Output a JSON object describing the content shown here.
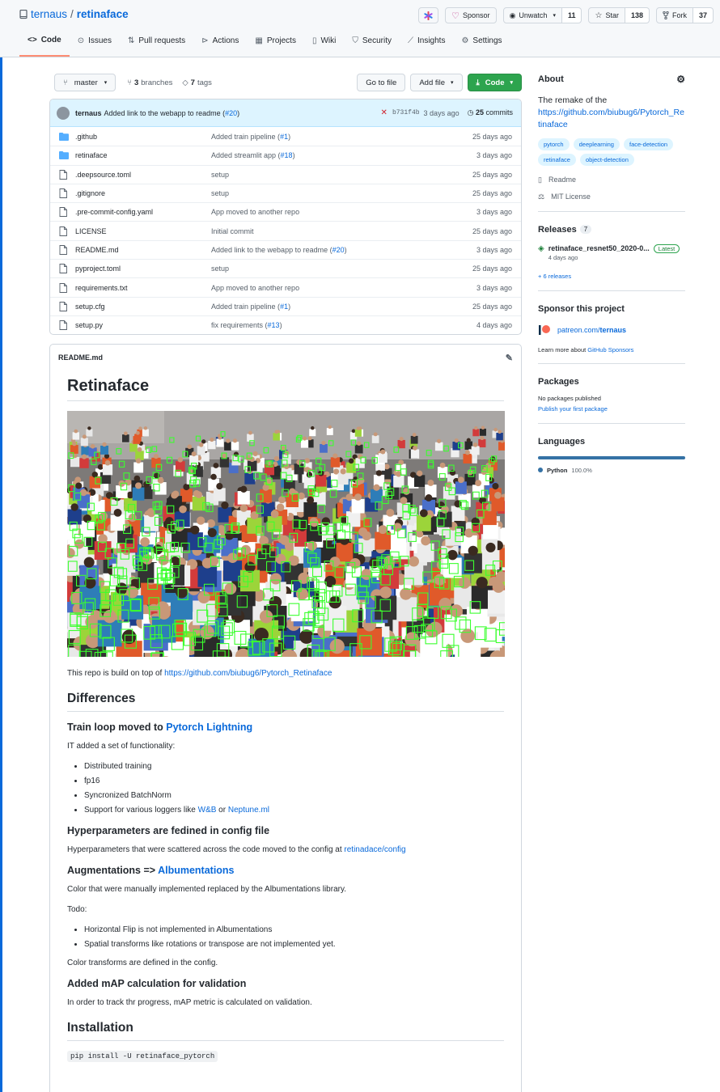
{
  "repo": {
    "owner": "ternaus",
    "separator": "/",
    "name": "retinaface",
    "sponsor_label": "Sponsor",
    "unwatch_label": "Unwatch",
    "watch_count": "11",
    "star_label": "Star",
    "star_count": "138",
    "fork_label": "Fork",
    "fork_count": "37"
  },
  "tabs": [
    "Code",
    "Issues",
    "Pull requests",
    "Actions",
    "Projects",
    "Wiki",
    "Security",
    "Insights",
    "Settings"
  ],
  "file_nav": {
    "branch": "master",
    "branches_count": "3",
    "branches_label": "branches",
    "tags_count": "7",
    "tags_label": "tags",
    "go_to_file": "Go to file",
    "add_file": "Add file",
    "code": "Code"
  },
  "commit": {
    "author": "ternaus",
    "message": "Added link to the webapp to readme (",
    "pr": "#20",
    "message_end": ")",
    "sha": "b731f4b",
    "ago": "3 days ago",
    "commits_count": "25",
    "commits_label": "commits"
  },
  "files": [
    {
      "name": ".github",
      "type": "folder",
      "msg": "Added train pipeline (",
      "pr": "#1",
      "age": "25 days ago"
    },
    {
      "name": "retinaface",
      "type": "folder",
      "msg": "Added streamlit app (",
      "pr": "#18",
      "age": "3 days ago"
    },
    {
      "name": ".deepsource.toml",
      "type": "file",
      "msg": "setup",
      "pr": "",
      "age": "25 days ago"
    },
    {
      "name": ".gitignore",
      "type": "file",
      "msg": "setup",
      "pr": "",
      "age": "25 days ago"
    },
    {
      "name": ".pre-commit-config.yaml",
      "type": "file",
      "msg": "App moved to another repo",
      "pr": "",
      "age": "3 days ago"
    },
    {
      "name": "LICENSE",
      "type": "file",
      "msg": "Initial commit",
      "pr": "",
      "age": "25 days ago"
    },
    {
      "name": "README.md",
      "type": "file",
      "msg": "Added link to the webapp to readme (",
      "pr": "#20",
      "age": "3 days ago"
    },
    {
      "name": "pyproject.toml",
      "type": "file",
      "msg": "setup",
      "pr": "",
      "age": "25 days ago"
    },
    {
      "name": "requirements.txt",
      "type": "file",
      "msg": "App moved to another repo",
      "pr": "",
      "age": "3 days ago"
    },
    {
      "name": "setup.cfg",
      "type": "file",
      "msg": "Added train pipeline (",
      "pr": "#1",
      "age": "25 days ago"
    },
    {
      "name": "setup.py",
      "type": "file",
      "msg": "fix requirements (",
      "pr": "#13",
      "age": "4 days ago"
    }
  ],
  "readme": {
    "filename": "README.md",
    "title": "Retinaface",
    "intro": "This repo is build on top of ",
    "intro_link": "https://github.com/biubug6/Pytorch_Retinaface",
    "h_differences": "Differences",
    "h_train_loop": "Train loop moved to ",
    "h_train_loop_link": "Pytorch Lightning",
    "functionality": "IT added a set of functionality:",
    "list1": [
      "Distributed training",
      "fp16",
      "Syncronized BatchNorm"
    ],
    "loggers_pre": "Support for various loggers like ",
    "loggers_wb": "W&B",
    "loggers_or": " or ",
    "loggers_neptune": "Neptune.ml",
    "h_hyper": "Hyperparameters are fedined in config file",
    "hyper_text": "Hyperparameters that were scattered across the code moved to the config at ",
    "hyper_link": "retinadace/config",
    "h_aug": "Augmentations => ",
    "h_aug_link": "Albumentations",
    "aug_text": "Color that were manually implemented replaced by the Albumentations library.",
    "todo": "Todo:",
    "list2": [
      "Horizontal Flip is not implemented in Albumentations",
      "Spatial transforms like rotations or transpose are not implemented yet."
    ],
    "color_text": "Color transforms are defined in the config.",
    "h_map": "Added mAP calculation for validation",
    "map_text": "In order to track thr progress, mAP metric is calculated on validation.",
    "h_install": "Installation",
    "install_cmd": "pip install -U retinaface_pytorch"
  },
  "about": {
    "title": "About",
    "desc": "The remake of the",
    "link": "https://github.com/biubug6/Pytorch_Retinaface",
    "topics": [
      "pytorch",
      "deeplearning",
      "face-detection",
      "retinaface",
      "object-detection"
    ],
    "readme": "Readme",
    "license": "MIT License"
  },
  "releases": {
    "title": "Releases",
    "count": "7",
    "name": "retinaface_resnet50_2020-0...",
    "latest": "Latest",
    "date": "4 days ago",
    "more": "+ 6 releases"
  },
  "sponsor": {
    "title": "Sponsor this project",
    "link_pre": "patreon.com/",
    "link_bold": "ternaus",
    "learn_pre": "Learn more about ",
    "learn_link": "GitHub Sponsors"
  },
  "packages": {
    "title": "Packages",
    "none": "No packages published",
    "publish": "Publish your first package"
  },
  "languages": {
    "title": "Languages",
    "name": "Python",
    "percent": "100.0%",
    "color": "#3572A5"
  }
}
